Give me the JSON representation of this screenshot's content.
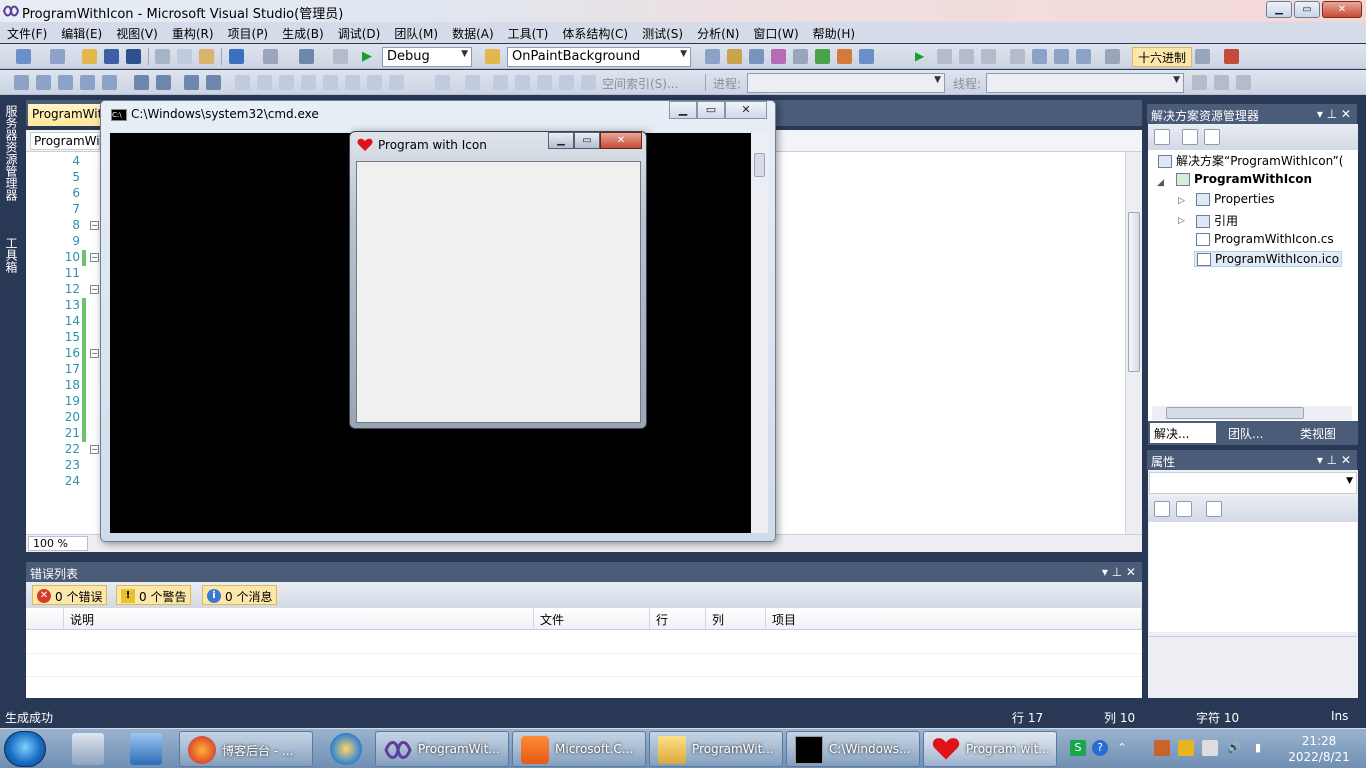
{
  "window": {
    "title": "ProgramWithIcon - Microsoft Visual Studio(管理员)",
    "controls": [
      "▁",
      "▭",
      "✕"
    ]
  },
  "menu": [
    "文件(F)",
    "编辑(E)",
    "视图(V)",
    "重构(R)",
    "项目(P)",
    "生成(B)",
    "调试(D)",
    "团队(M)",
    "数据(A)",
    "工具(T)",
    "体系结构(C)",
    "测试(S)",
    "分析(N)",
    "窗口(W)",
    "帮助(H)"
  ],
  "toolbar": {
    "config": "Debug",
    "find": "OnPaintBackground",
    "hex": "十六进制",
    "search_placeholder": "空间索引(S)...",
    "process_label": "进程:",
    "thread_label": "线程:"
  },
  "sidebar_left": {
    "server_explorer": "服务器资源管理器",
    "toolbox": "工具箱"
  },
  "editor": {
    "tab": "ProgramWithIcon.cs",
    "nav_left": "ProgramWithIcon",
    "line_numbers": [
      "4",
      "5",
      "6",
      "7",
      "8",
      "9",
      "10",
      "11",
      "12",
      "13",
      "14",
      "15",
      "16",
      "17",
      "18",
      "19",
      "20",
      "21",
      "22",
      "23",
      "24"
    ],
    "zoom": "100 %"
  },
  "console": {
    "title": "C:\\Windows\\system32\\cmd.exe",
    "controls": [
      "▁",
      "▭",
      "✕"
    ]
  },
  "form": {
    "title": "Program with Icon",
    "controls": [
      "▁",
      "▭",
      "✕"
    ]
  },
  "error_list": {
    "title": "错误列表",
    "errors": "0 个错误",
    "warnings": "0 个警告",
    "messages": "0 个消息",
    "columns": [
      "说明",
      "文件",
      "行",
      "列",
      "项目"
    ]
  },
  "solution_explorer": {
    "title": "解决方案资源管理器",
    "items": [
      "解决方案“ProgramWithIcon”(",
      "ProgramWithIcon",
      "Properties",
      "引用",
      "ProgramWithIcon.cs",
      "ProgramWithIcon.ico"
    ],
    "tabs": [
      "解决...",
      "团队...",
      "类视图"
    ]
  },
  "properties": {
    "title": "属性"
  },
  "status": {
    "message": "生成成功",
    "line": "行 17",
    "col": "列 10",
    "char": "字符 10",
    "mode": "Ins"
  },
  "taskbar": {
    "buttons": [
      "博客后台 - ...",
      "ProgramWit...",
      "Microsoft.C...",
      "ProgramWit...",
      "C:\\Windows...",
      "Program wit..."
    ],
    "time": "21:28",
    "date": "2022/8/21"
  }
}
